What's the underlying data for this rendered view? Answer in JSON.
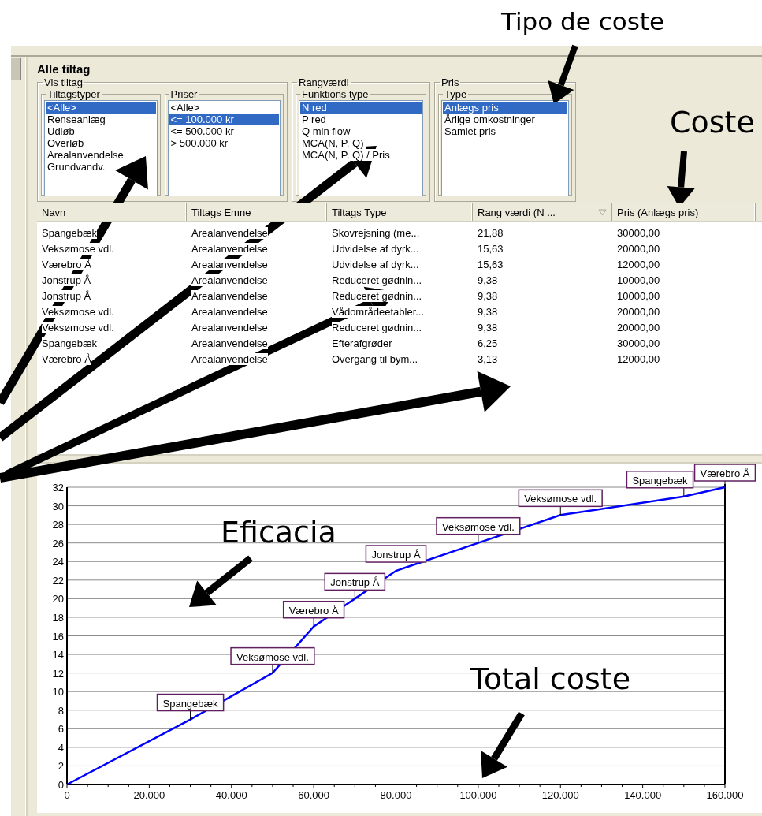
{
  "panel": {
    "title": "Alle tiltag",
    "groups": [
      {
        "title": "Vis tiltag",
        "lists": [
          {
            "title": "Tiltagstyper",
            "items": [
              {
                "label": "<Alle>",
                "selected": true
              },
              {
                "label": "Renseanlæg",
                "selected": false
              },
              {
                "label": "Udløb",
                "selected": false
              },
              {
                "label": "Overløb",
                "selected": false
              },
              {
                "label": "Arealanvendelse",
                "selected": false
              },
              {
                "label": "Grundvandv.",
                "selected": false
              }
            ]
          },
          {
            "title": "Priser",
            "items": [
              {
                "label": "<Alle>",
                "selected": false
              },
              {
                "label": "<= 100.000 kr",
                "selected": true
              },
              {
                "label": "<= 500.000 kr",
                "selected": false
              },
              {
                "label": "> 500.000 kr",
                "selected": false
              }
            ]
          }
        ]
      },
      {
        "title": "Rangværdi",
        "lists": [
          {
            "title": "Funktions type",
            "items": [
              {
                "label": "N red",
                "selected": true
              },
              {
                "label": "P red",
                "selected": false
              },
              {
                "label": "Q min flow",
                "selected": false
              },
              {
                "label": "MCA(N, P, Q)",
                "selected": false
              },
              {
                "label": "MCA(N, P, Q) / Pris",
                "selected": false
              }
            ]
          }
        ]
      },
      {
        "title": "Pris",
        "lists": [
          {
            "title": "Type",
            "items": [
              {
                "label": "Anlægs pris",
                "selected": true
              },
              {
                "label": "Årlige omkostninger",
                "selected": false
              },
              {
                "label": "Samlet pris",
                "selected": false
              }
            ]
          }
        ]
      }
    ]
  },
  "table": {
    "columns": [
      {
        "label": "Navn",
        "sorted": false
      },
      {
        "label": "Tiltags Emne",
        "sorted": false
      },
      {
        "label": "Tiltags Type",
        "sorted": false
      },
      {
        "label": "Rang værdi (N ...",
        "sorted": true
      },
      {
        "label": "Pris (Anlægs pris)",
        "sorted": false
      }
    ],
    "rows": [
      [
        "Spangebæk",
        "Arealanvendelse",
        "Skovrejsning (me...",
        "21,88",
        "30000,00"
      ],
      [
        "Veksømose vdl.",
        "Arealanvendelse",
        "Udvidelse af dyrk...",
        "15,63",
        "20000,00"
      ],
      [
        "Værebro Å",
        "Arealanvendelse",
        "Udvidelse af dyrk...",
        "15,63",
        "12000,00"
      ],
      [
        "Jonstrup Å",
        "Arealanvendelse",
        "Reduceret gødnin...",
        "9,38",
        "10000,00"
      ],
      [
        "Jonstrup Å",
        "Arealanvendelse",
        "Reduceret gødnin...",
        "9,38",
        "10000,00"
      ],
      [
        "Veksømose vdl.",
        "Arealanvendelse",
        "Vådområdeetabler...",
        "9,38",
        "20000,00"
      ],
      [
        "Veksømose vdl.",
        "Arealanvendelse",
        "Reduceret gødnin...",
        "9,38",
        "20000,00"
      ],
      [
        "Spangebæk",
        "Arealanvendelse",
        "Efterafgrøder",
        "6,25",
        "30000,00"
      ],
      [
        "Værebro Å",
        "Arealanvendelse",
        "Overgang til bym...",
        "3,13",
        "12000,00"
      ]
    ]
  },
  "chart": {
    "chart_data": {
      "type": "line",
      "x": [
        0,
        30000,
        50000,
        60000,
        70000,
        80000,
        100000,
        120000,
        150000,
        160000
      ],
      "series": [
        {
          "color": "#0000ff",
          "values": [
            0,
            7,
            12,
            17,
            20,
            23,
            26,
            29,
            31,
            32
          ]
        }
      ],
      "xlim": [
        0,
        160000
      ],
      "ylim": [
        0,
        32
      ],
      "grid": true,
      "yticks": [
        0,
        2,
        4,
        6,
        8,
        10,
        12,
        14,
        16,
        18,
        20,
        22,
        24,
        26,
        28,
        30,
        32
      ],
      "xticks": [
        {
          "value": 0,
          "label": "0"
        },
        {
          "value": 20000,
          "label": "20.000"
        },
        {
          "value": 40000,
          "label": "40.000"
        },
        {
          "value": 60000,
          "label": "60.000"
        },
        {
          "value": 80000,
          "label": "80.000"
        },
        {
          "value": 100000,
          "label": "100.000"
        },
        {
          "value": 120000,
          "label": "120.000"
        },
        {
          "value": 140000,
          "label": "140.000"
        },
        {
          "value": 160000,
          "label": "160.000"
        }
      ],
      "annotations": [
        {
          "x": 30000,
          "y": 7,
          "text": "Spangebæk"
        },
        {
          "x": 50000,
          "y": 12,
          "text": "Veksømose vdl."
        },
        {
          "x": 60000,
          "y": 17,
          "text": "Værebro Å"
        },
        {
          "x": 70000,
          "y": 20,
          "text": "Jonstrup Å"
        },
        {
          "x": 80000,
          "y": 23,
          "text": "Jonstrup Å"
        },
        {
          "x": 100000,
          "y": 26,
          "text": "Veksømose vdl."
        },
        {
          "x": 120000,
          "y": 29,
          "text": "Veksømose vdl."
        },
        {
          "x": 150000,
          "y": 31,
          "text": "Spangebæk"
        },
        {
          "x": 160000,
          "y": 32,
          "text": "Værebro Å"
        }
      ]
    }
  },
  "annotations": [
    {
      "text": "Tipo de coste"
    },
    {
      "text": "Coste"
    },
    {
      "text": "Eficacia"
    },
    {
      "text": "Total coste"
    }
  ]
}
